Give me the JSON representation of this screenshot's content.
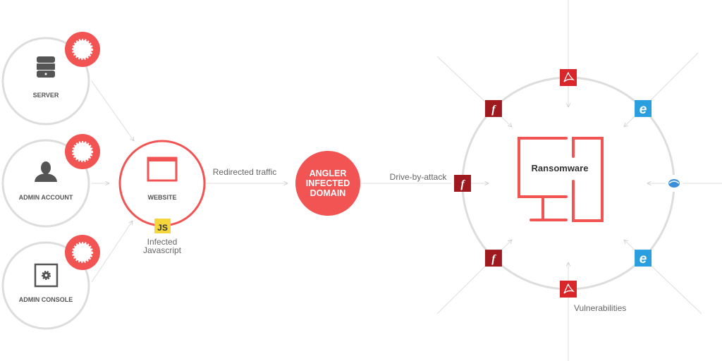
{
  "sources": [
    {
      "label": "SERVER",
      "icon": "server-icon"
    },
    {
      "label": "ADMIN ACCOUNT",
      "icon": "user-icon"
    },
    {
      "label": "ADMIN CONSOLE",
      "icon": "gear-icon"
    }
  ],
  "website": {
    "label": "WEBSITE",
    "badge": "JS",
    "caption_line1": "Infected",
    "caption_line2": "Javascript"
  },
  "edge_redirect": "Redirected traffic",
  "angler": {
    "line1": "ANGLER",
    "line2": "INFECTED",
    "line3": "DOMAIN"
  },
  "edge_drive": "Drive-by-attack",
  "target": {
    "label": "Ransomware"
  },
  "vulnerabilities_label": "Vulnerabilities",
  "vulnerability_icons": [
    "pdf-icon",
    "ie-icon",
    "browser-plugin-icon",
    "ie-icon",
    "pdf-icon",
    "flash-icon",
    "flash-icon",
    "flash-icon"
  ],
  "colors": {
    "accent": "#f25454",
    "ring": "#dddddd",
    "text": "#555555",
    "js": "#f5d63d",
    "flash": "#9e1a1f",
    "pdf": "#d9262b",
    "ie": "#2a9fe0"
  }
}
